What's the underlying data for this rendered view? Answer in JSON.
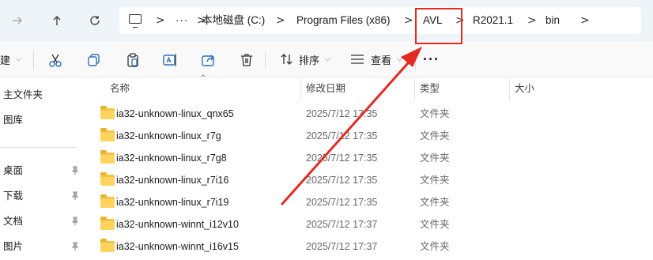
{
  "nav": {
    "forward_icon": "arrow-right-icon",
    "up_icon": "arrow-up-icon",
    "refresh_icon": "refresh-icon"
  },
  "address": {
    "pc_icon": "computer-icon",
    "overflow": "···",
    "crumbs": [
      "本地磁盘 (C:)",
      "Program Files (x86)",
      "AVL",
      "R2021.1",
      "bin"
    ],
    "separator": ">"
  },
  "toolbar": {
    "new_label": "建",
    "sort_label": "排序",
    "view_label": "查看",
    "more_label": "···",
    "icons": [
      "cut-icon",
      "copy-icon",
      "paste-icon",
      "rename-icon",
      "share-icon",
      "delete-icon"
    ]
  },
  "sidebar": {
    "items": [
      {
        "label": "主文件夹",
        "pinned": false
      },
      {
        "label": "图库",
        "pinned": false
      },
      {
        "label": "桌面",
        "pinned": true
      },
      {
        "label": "下载",
        "pinned": true
      },
      {
        "label": "文档",
        "pinned": true
      },
      {
        "label": "图片",
        "pinned": true
      }
    ]
  },
  "columns": {
    "name": "名称",
    "modified": "修改日期",
    "type": "类型",
    "size": "大小"
  },
  "files": [
    {
      "name": "ia32-unknown-linux_qnx65",
      "modified": "2025/7/12 17:35",
      "type": "文件夹"
    },
    {
      "name": "ia32-unknown-linux_r7g",
      "modified": "2025/7/12 17:35",
      "type": "文件夹"
    },
    {
      "name": "ia32-unknown-linux_r7g8",
      "modified": "2025/7/12 17:35",
      "type": "文件夹"
    },
    {
      "name": "ia32-unknown-linux_r7i16",
      "modified": "2025/7/12 17:35",
      "type": "文件夹"
    },
    {
      "name": "ia32-unknown-linux_r7i19",
      "modified": "2025/7/12 17:35",
      "type": "文件夹"
    },
    {
      "name": "ia32-unknown-winnt_i12v10",
      "modified": "2025/7/12 17:37",
      "type": "文件夹"
    },
    {
      "name": "ia32-unknown-winnt_i16v15",
      "modified": "2025/7/12 17:37",
      "type": "文件夹"
    }
  ],
  "annotation": {
    "color": "#e52a23",
    "highlighted_crumb": "AVL"
  }
}
